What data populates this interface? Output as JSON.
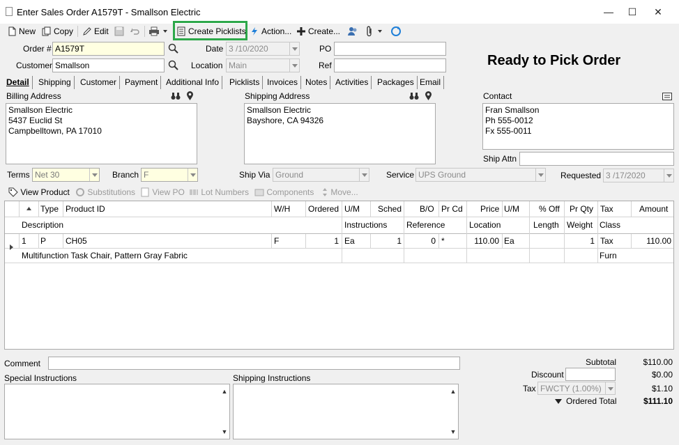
{
  "window": {
    "title": "Enter Sales Order A1579T - Smallson Electric",
    "minimize_label": "—",
    "maximize_label": "☐",
    "close_label": "✕"
  },
  "toolbar": {
    "new_label": "New",
    "copy_label": "Copy",
    "edit_label": "Edit",
    "create_picklists_label": "Create Picklists",
    "action_label": "Action...",
    "create_label": "Create..."
  },
  "header": {
    "order_label": "Order #",
    "order_value": "A1579T",
    "date_label": "Date",
    "date_value": "3 /10/2020",
    "po_label": "PO",
    "po_value": "",
    "customer_label": "Customer",
    "customer_value": "Smallson",
    "location_label": "Location",
    "location_value": "Main",
    "ref_label": "Ref",
    "ref_value": "",
    "status_text": "Ready to Pick Order"
  },
  "tabs": [
    {
      "label": "Detail"
    },
    {
      "label": "Shipping"
    },
    {
      "label": "Customer"
    },
    {
      "label": "Payment"
    },
    {
      "label": "Additional Info"
    },
    {
      "label": "Picklists"
    },
    {
      "label": "Invoices"
    },
    {
      "label": "Notes"
    },
    {
      "label": "Activities"
    },
    {
      "label": "Packages"
    },
    {
      "label": "Email"
    }
  ],
  "addresses": {
    "billing_label": "Billing Address",
    "billing_text": "Smallson Electric\n5437 Euclid St\nCampbelltown, PA 17010",
    "shipping_label": "Shipping Address",
    "shipping_text": "Smallson Electric\nBayshore, CA 94326",
    "contact_label": "Contact",
    "contact_text": "Fran Smallson\nPh 555-0012\nFx 555-0011",
    "ship_attn_label": "Ship Attn",
    "ship_attn_value": ""
  },
  "terms_row": {
    "terms_label": "Terms",
    "terms_value": "Net 30",
    "branch_label": "Branch",
    "branch_value": "F",
    "ship_via_label": "Ship Via",
    "ship_via_value": "Ground",
    "service_label": "Service",
    "service_value": "UPS Ground",
    "requested_label": "Requested",
    "requested_value": "3 /17/2020"
  },
  "line_toolbar": {
    "view_product": "View Product",
    "substitutions": "Substitutions",
    "view_po": "View PO",
    "lot_numbers": "Lot Numbers",
    "components": "Components",
    "move": "Move..."
  },
  "grid": {
    "headers_row1": [
      "Type",
      "Product ID",
      "W/H",
      "Ordered",
      "U/M",
      "Sched",
      "B/O",
      "Pr Cd",
      "Price",
      "U/M",
      "% Off",
      "Pr Qty",
      "Tax",
      "Amount"
    ],
    "headers_row2": [
      "Description",
      "Instructions",
      "Reference",
      "Location",
      "Length",
      "Weight",
      "Class"
    ],
    "rows": [
      {
        "line": "1",
        "type": "P",
        "product_id": "CH05",
        "wh": "F",
        "ordered": "1",
        "um": "Ea",
        "sched": "1",
        "bo": "0",
        "prcd": "*",
        "price": "110.00",
        "um2": "Ea",
        "pct_off": "",
        "pr_qty": "1",
        "tax": "Tax",
        "amount": "110.00",
        "description": "Multifunction Task Chair, Pattern Gray Fabric",
        "class": "Furn"
      }
    ]
  },
  "footer": {
    "comment_label": "Comment",
    "comment_value": "",
    "special_label": "Special Instructions",
    "shipping_instr_label": "Shipping Instructions",
    "subtotal_label": "Subtotal",
    "subtotal_value": "$110.00",
    "discount_label": "Discount",
    "discount_value": "$0.00",
    "tax_label": "Tax",
    "tax_code": "FWCTY (1.00%)",
    "tax_value": "$1.10",
    "ordered_total_label": "Ordered Total",
    "ordered_total_value": "$111.10"
  },
  "colors": {
    "highlight": "#2da84a",
    "required_field": "#ffffe1",
    "disabled_text": "#8a8a8a"
  }
}
